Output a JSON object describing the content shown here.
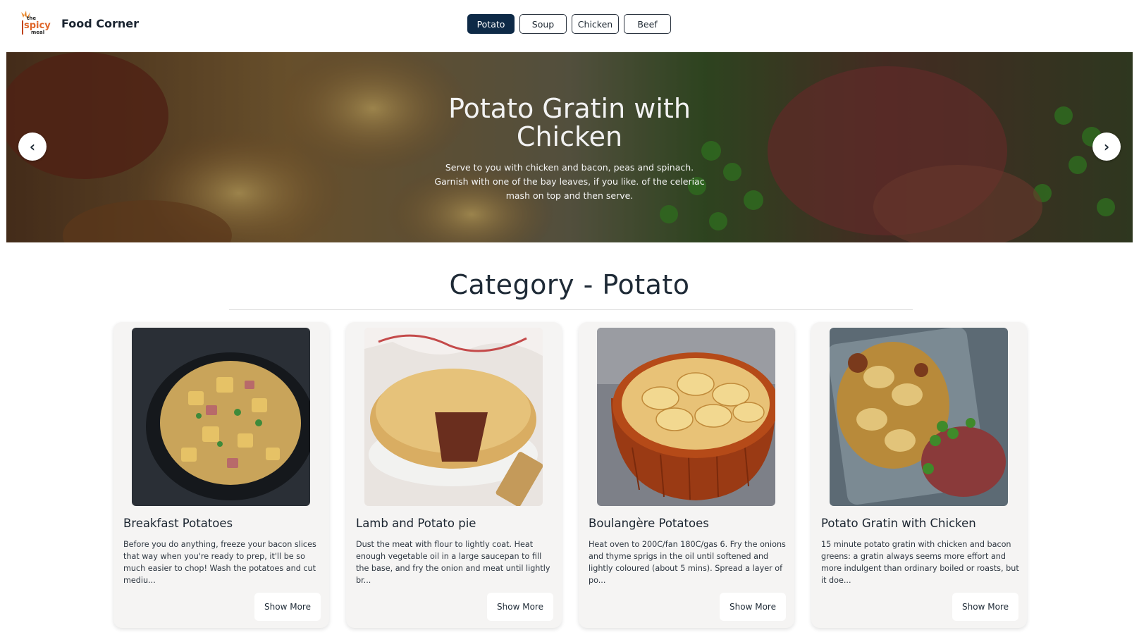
{
  "header": {
    "logo_text": [
      "the",
      "spicy",
      "meal"
    ],
    "brand": "Food Corner",
    "nav": [
      {
        "label": "Potato",
        "active": true
      },
      {
        "label": "Soup",
        "active": false
      },
      {
        "label": "Chicken",
        "active": false
      },
      {
        "label": "Beef",
        "active": false
      }
    ]
  },
  "hero": {
    "title_line1": "Potato Gratin with",
    "title_line2": "Chicken",
    "description": "Serve to you with chicken and bacon, peas and spinach. Garnish with one of the bay leaves, if you like. of the celeriac mash on top and then serve.",
    "prev_symbol": "‹",
    "next_symbol": "›"
  },
  "category": {
    "title": "Category - Potato"
  },
  "cards": [
    {
      "title": "Breakfast Potatoes",
      "description": "Before you do anything, freeze your bacon slices that way when you're ready to prep, it'll be so much easier to chop! Wash the potatoes and cut mediu...",
      "button": "Show More",
      "image_icon": "skillet-potatoes-image"
    },
    {
      "title": "Lamb and Potato pie",
      "description": "Dust the meat with flour to lightly coat. Heat enough vegetable oil in a large saucepan to fill the base, and fry the onion and meat until lightly br...",
      "button": "Show More",
      "image_icon": "meat-pie-image"
    },
    {
      "title": "Boulangère Potatoes",
      "description": "Heat oven to 200C/fan 180C/gas 6. Fry the onions and thyme sprigs in the oil until softened and lightly coloured (about 5 mins). Spread a layer of po...",
      "button": "Show More",
      "image_icon": "potato-dish-image"
    },
    {
      "title": "Potato Gratin with Chicken",
      "description": "15 minute potato gratin with chicken and bacon greens: a gratin always seems more effort and more indulgent than ordinary boiled or roasts, but it doe...",
      "button": "Show More",
      "image_icon": "gratin-image"
    }
  ]
}
